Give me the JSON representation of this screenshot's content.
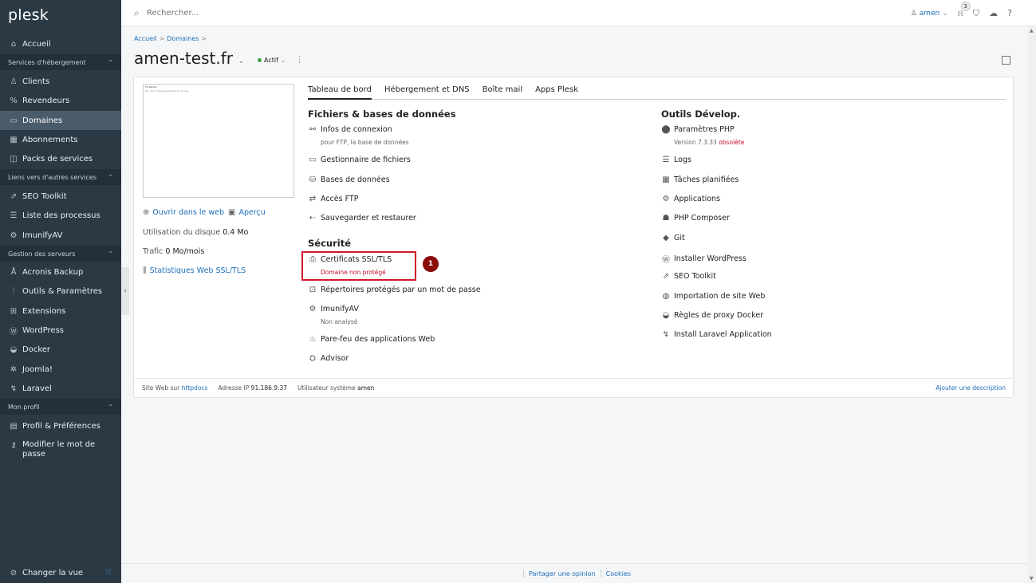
{
  "sidebar": {
    "logo": "plesk",
    "home": "Accueil",
    "sections": [
      {
        "title": "Services d'hébergement",
        "items": [
          "Clients",
          "Revendeurs",
          "Domaines",
          "Abonnements",
          "Packs de services"
        ]
      },
      {
        "title": "Liens vers d'autres services",
        "items": [
          "SEO Toolkit",
          "Liste des processus",
          "ImunifyAV"
        ]
      },
      {
        "title": "Gestion des serveurs",
        "items": [
          "Acronis Backup",
          "Outils & Paramètres",
          "Extensions",
          "WordPress",
          "Docker",
          "Joomla!",
          "Laravel"
        ]
      },
      {
        "title": "Mon profil",
        "items": [
          "Profil & Préférences",
          "Modifier le mot de passe"
        ]
      }
    ],
    "change_view": "Changer la vue",
    "active": "Domaines"
  },
  "topbar": {
    "search_placeholder": "Rechercher...",
    "user": "amen",
    "notif_count": "3"
  },
  "breadcrumb": [
    "Accueil",
    "Domaines"
  ],
  "domain": {
    "name": "amen-test.fr",
    "status": "Actif"
  },
  "left": {
    "thumb_title": "Forbidden",
    "thumb_text": "You don't have permission to access",
    "open_web": "Ouvrir dans le web",
    "preview": "Aperçu",
    "disk_label": "Utilisation du disque",
    "disk_value": "0.4 Mo",
    "traffic_label": "Trafic",
    "traffic_value": "0 Mo/mois",
    "stats": "Statistiques Web SSL/TLS"
  },
  "tabs": [
    "Tableau de bord",
    "Hébergement et DNS",
    "Boîte mail",
    "Apps Plesk"
  ],
  "files": {
    "title": "Fichiers & bases de données",
    "connexion": "Infos de connexion",
    "connexion_sub": "pour FTP, la base de données",
    "file_manager": "Gestionnaire de fichiers",
    "databases": "Bases de données",
    "ftp": "Accès FTP",
    "backup": "Sauvegarder et restaurer"
  },
  "security": {
    "title": "Sécurité",
    "ssl": "Certificats SSL/TLS",
    "ssl_sub": "Domaine non protégé",
    "protected_dirs": "Répertoires protégés par un mot de passe",
    "imunify": "ImunifyAV",
    "imunify_sub": "Non analysé",
    "waf": "Pare-feu des applications Web",
    "advisor": "Advisor"
  },
  "dev": {
    "title": "Outils Dévelop.",
    "php": "Paramètres PHP",
    "php_version": "Version 7.3.33",
    "php_obsolete": "obsolète",
    "logs": "Logs",
    "cron": "Tâches planifiées",
    "apps": "Applications",
    "composer": "PHP Composer",
    "git": "Git",
    "wp": "Installer WordPress",
    "seo": "SEO Toolkit",
    "import": "Importation de site Web",
    "docker_proxy": "Règles de proxy Docker",
    "laravel": "Install Laravel Application"
  },
  "step_badge": "1",
  "card_footer": {
    "site_label": "Site Web sur",
    "site_value": "httpdocs",
    "ip_label": "Adresse IP",
    "ip_value": "91.186.9.37",
    "user_label": "Utilisateur système",
    "user_value": "amen",
    "add_desc": "Ajouter une description"
  },
  "footer": {
    "feedback": "Partager une opinion",
    "cookies": "Cookies"
  }
}
